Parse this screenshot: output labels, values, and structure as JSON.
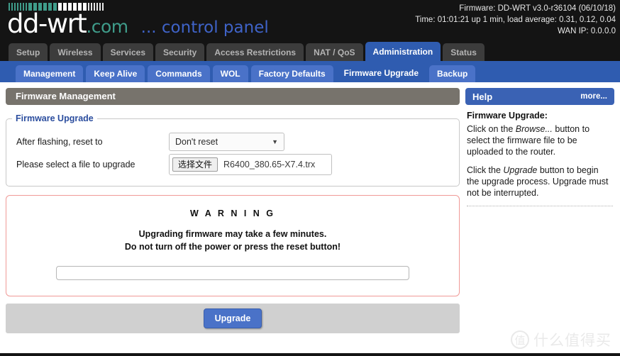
{
  "header": {
    "logo_main": "dd-wrt",
    "logo_suffix": ".com",
    "logo_tagline": "... control panel",
    "firmware_line": "Firmware: DD-WRT v3.0-r36104 (06/10/18)",
    "time_line": "Time: 01:01:21 up 1 min, load average: 0.31, 0.12, 0.04",
    "wan_line": "WAN IP: 0.0.0.0"
  },
  "primary_tabs": [
    {
      "label": "Setup",
      "active": false
    },
    {
      "label": "Wireless",
      "active": false
    },
    {
      "label": "Services",
      "active": false
    },
    {
      "label": "Security",
      "active": false
    },
    {
      "label": "Access Restrictions",
      "active": false
    },
    {
      "label": "NAT / QoS",
      "active": false
    },
    {
      "label": "Administration",
      "active": true
    },
    {
      "label": "Status",
      "active": false
    }
  ],
  "secondary_tabs": [
    {
      "label": "Management",
      "active": false
    },
    {
      "label": "Keep Alive",
      "active": false
    },
    {
      "label": "Commands",
      "active": false
    },
    {
      "label": "WOL",
      "active": false
    },
    {
      "label": "Factory Defaults",
      "active": false
    },
    {
      "label": "Firmware Upgrade",
      "active": true
    },
    {
      "label": "Backup",
      "active": false
    }
  ],
  "main": {
    "panel_title": "Firmware Management",
    "fieldset_legend": "Firmware Upgrade",
    "reset_label": "After flashing, reset to",
    "reset_value": "Don't reset",
    "reset_arrow": "▼",
    "file_label": "Please select a file to upgrade",
    "file_button": "选择文件",
    "file_name": "R6400_380.65-X7.4.trx",
    "warning_title": "W A R N I N G",
    "warning_line1": "Upgrading firmware may take a few minutes.",
    "warning_line2": "Do not turn off the power or press the reset button!",
    "progress_percent": 0,
    "upgrade_button": "Upgrade"
  },
  "sidebar": {
    "help_title": "Help",
    "help_more": "more...",
    "help_heading": "Firmware Upgrade:",
    "help_para1_a": "Click on the ",
    "help_para1_i": "Browse...",
    "help_para1_b": " button to select the firmware file to be uploaded to the router.",
    "help_para2_a": "Click the ",
    "help_para2_i": "Upgrade",
    "help_para2_b": " button to begin the upgrade process. Upgrade must not be interrupted."
  },
  "watermark": {
    "mark": "值",
    "text": "什么值得买"
  },
  "colors": {
    "accent_blue": "#2f5cb0",
    "tab_blue": "#4a72c8",
    "logo_teal": "#3f9c8a",
    "panel_gray": "#77736c",
    "warning_border": "#f09a97"
  }
}
